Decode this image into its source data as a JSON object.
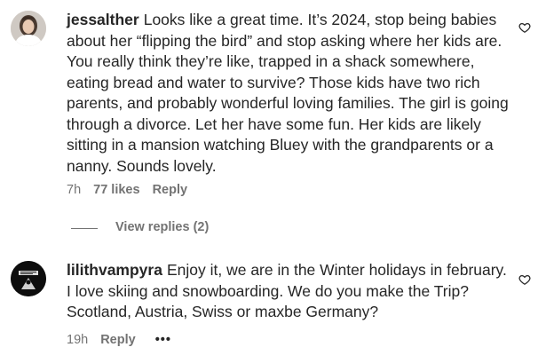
{
  "comments": [
    {
      "username": "jessalther",
      "text": "Looks like a great time. It’s 2024, stop being babies about her “flipping the bird” and stop asking where her kids are. You really think they’re like, trapped in a shack somewhere, eating bread and water to survive? Those kids have two rich parents, and probably wonderful loving families. The girl is going through a divorce. Let her have some fun. Her kids are likely sitting in a mansion watching Bluey with the grandparents or a nanny. Sounds lovely.",
      "time": "7h",
      "likes": "77 likes",
      "reply_label": "Reply",
      "view_replies": "View replies (2)",
      "avatar_icon": "profile-photo-woman",
      "like_icon": "heart-outline-icon"
    },
    {
      "username": "lilithvampyra",
      "text": "Enjoy it, we are in the Winter holidays in february. I love skiing and snowboarding. We do you make the Trip? Scotland, Austria, Swiss or maxbe Germany?",
      "time": "19h",
      "reply_label": "Reply",
      "more_label": "•••",
      "avatar_icon": "profile-photo-dark-logo",
      "like_icon": "heart-outline-icon"
    }
  ],
  "colors": {
    "text": "#262626",
    "secondary": "#737373",
    "background": "#ffffff"
  }
}
